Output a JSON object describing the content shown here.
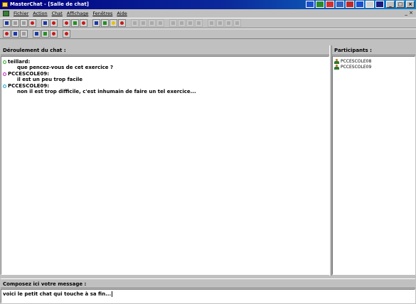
{
  "window": {
    "title": "MasterChat - [Salle de chat]",
    "controls": [
      "_",
      "□",
      "×"
    ],
    "mdi_controls": "_ ×",
    "taskbar_colors": [
      "#1a4fd0",
      "#2a8a2a",
      "#d23030",
      "#3060c0",
      "#c02828",
      "#1a4fd0",
      "#d0d0d0",
      "#1a1a80"
    ]
  },
  "menu": {
    "items": [
      "Fichier",
      "Action",
      "Chat",
      "Affichage",
      "Fenêtres",
      "Aide"
    ]
  },
  "chat": {
    "header": "Déroulement du chat :",
    "messages": [
      {
        "author": "teillard:",
        "text": "que pencez-vous de cet exercice ?",
        "dot_color": "#22aa22"
      },
      {
        "author": "PCCESCOLE09:",
        "text": "il est un peu trop facile",
        "dot_color": "#c020c0"
      },
      {
        "author": "PCCESCOLE09:",
        "text": "non il est trop difficile, c'est inhumain de faire un tel exercice...",
        "dot_color": "#20a0c0"
      }
    ]
  },
  "participants": {
    "header": "Participants :",
    "list": [
      "PCCESCOLE08",
      "PCCESCOLE09"
    ]
  },
  "compose": {
    "header": "Composez ici votre message :",
    "value": "voici le petit chat qui touche à sa fin..."
  }
}
